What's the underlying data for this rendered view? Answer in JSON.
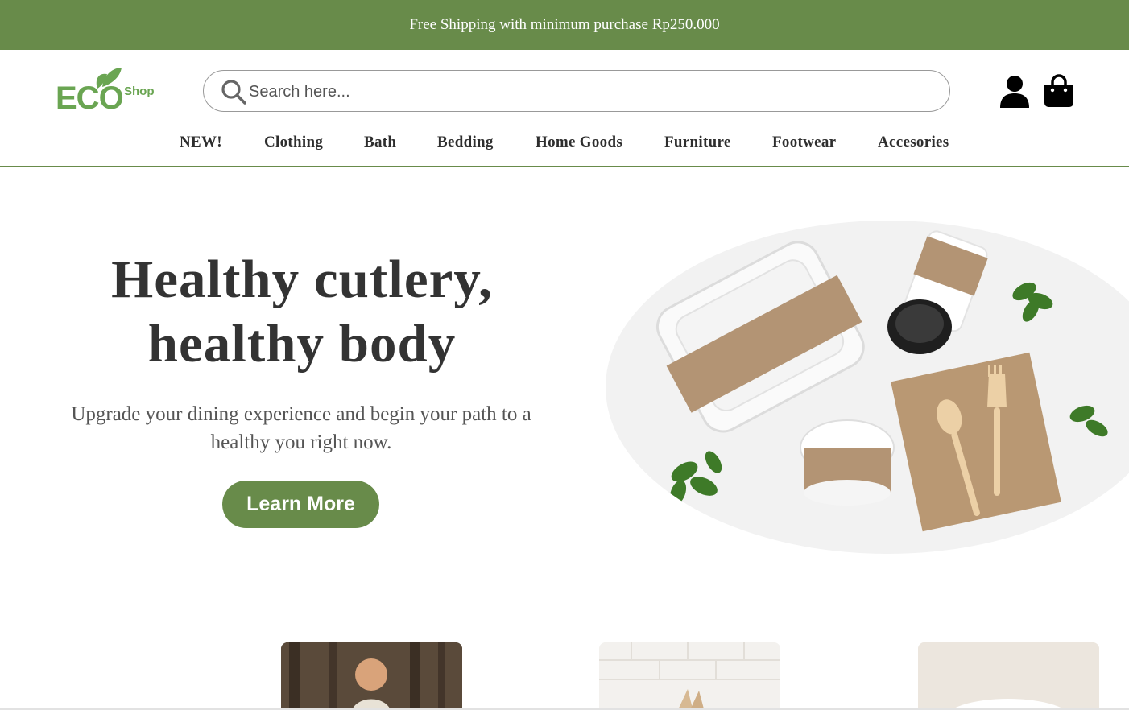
{
  "banner": {
    "text": "Free Shipping with minimum purchase Rp250.000"
  },
  "header": {
    "logo": {
      "main": "ECO",
      "sub": "Shop"
    },
    "search": {
      "placeholder": "Search here...",
      "value": ""
    },
    "icons": {
      "account": "user-icon",
      "cart": "shopping-bag-icon"
    }
  },
  "nav": {
    "items": [
      {
        "label": "NEW!"
      },
      {
        "label": "Clothing"
      },
      {
        "label": "Bath"
      },
      {
        "label": "Bedding"
      },
      {
        "label": "Home Goods"
      },
      {
        "label": "Furniture"
      },
      {
        "label": "Footwear"
      },
      {
        "label": "Accesories"
      }
    ]
  },
  "hero": {
    "title_line1": "Healthy cutlery,",
    "title_line2": "healthy body",
    "subtitle": "Upgrade your dining experience and begin your path to a healthy you right now.",
    "button_label": "Learn More"
  },
  "colors": {
    "brand_green": "#688b4a",
    "logo_green": "#6aa552",
    "text_dark": "#333333"
  }
}
